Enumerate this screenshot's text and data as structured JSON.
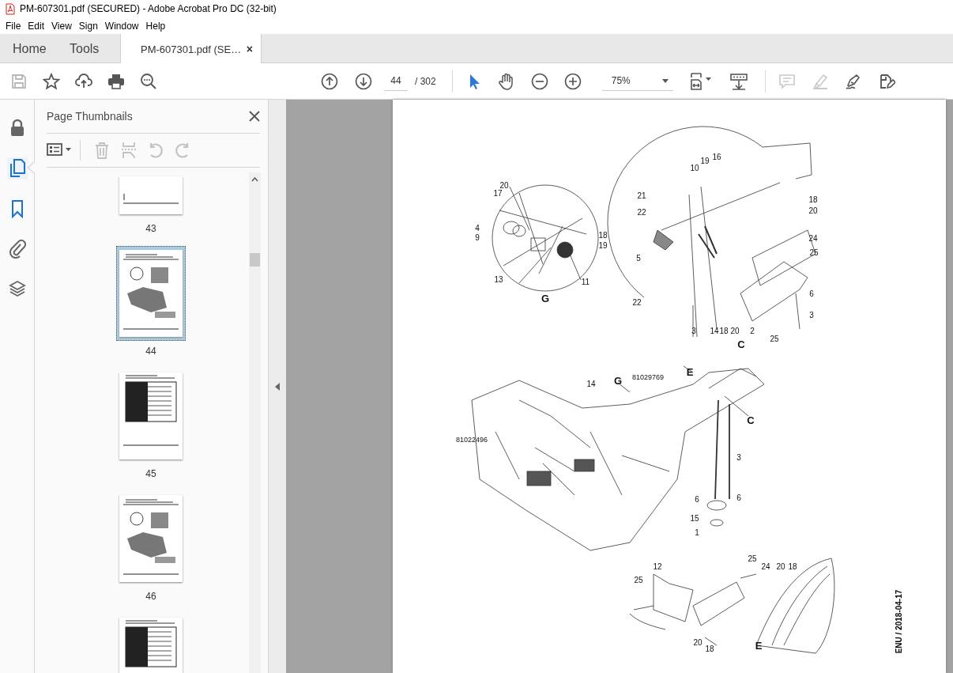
{
  "window": {
    "title": "PM-607301.pdf (SECURED) - Adobe Acrobat Pro DC (32-bit)"
  },
  "menu": [
    "File",
    "Edit",
    "View",
    "Sign",
    "Window",
    "Help"
  ],
  "tabs": [
    {
      "label": "Home",
      "selected": false,
      "kind": "nav"
    },
    {
      "label": "Tools",
      "selected": false,
      "kind": "nav"
    },
    {
      "label": "PM-607301.pdf (SE…",
      "selected": true,
      "kind": "document",
      "close": "×"
    }
  ],
  "toolbar": {
    "file_tools": [
      {
        "kind": "save",
        "disabled": true
      },
      {
        "kind": "star",
        "disabled": false
      },
      {
        "kind": "upload",
        "disabled": false
      },
      {
        "kind": "print",
        "disabled": false
      },
      {
        "kind": "find",
        "disabled": false
      }
    ],
    "page_number": "44",
    "page_count": "/ 302",
    "view_tools": [
      {
        "kind": "select",
        "selected": true
      },
      {
        "kind": "hand",
        "selected": false
      }
    ],
    "zoom": "75%",
    "edit_tools": [
      {
        "kind": "comment",
        "disabled": true
      },
      {
        "kind": "highlight",
        "disabled": true
      },
      {
        "kind": "sign",
        "disabled": false
      },
      {
        "kind": "edit",
        "disabled": false
      }
    ]
  },
  "rail": [
    {
      "kind": "lock",
      "selected": false
    },
    {
      "kind": "pages",
      "selected": true
    },
    {
      "kind": "bookmark",
      "selected": false
    },
    {
      "kind": "attachment",
      "selected": false
    },
    {
      "kind": "layers",
      "selected": false
    }
  ],
  "panel": {
    "title": "Page Thumbnails",
    "tools": [
      {
        "kind": "options",
        "disabled": false
      },
      {
        "kind": "delete",
        "disabled": true
      },
      {
        "kind": "extract",
        "disabled": true
      },
      {
        "kind": "undo",
        "disabled": true
      },
      {
        "kind": "redo",
        "disabled": true
      }
    ],
    "thumbnails": [
      {
        "label": "43",
        "selected": false,
        "kind": "blank"
      },
      {
        "label": "44",
        "selected": true,
        "kind": "drawing"
      },
      {
        "label": "45",
        "selected": false,
        "kind": "table"
      },
      {
        "label": "46",
        "selected": false,
        "kind": "drawing"
      },
      {
        "selected": false,
        "kind": "table"
      }
    ]
  },
  "document": {
    "callouts": [
      {
        "text": "20",
        "kind": "number"
      },
      {
        "text": "17",
        "kind": "number"
      },
      {
        "text": "4",
        "kind": "number"
      },
      {
        "text": "9",
        "kind": "number"
      },
      {
        "text": "18",
        "kind": "number"
      },
      {
        "text": "19",
        "kind": "number"
      },
      {
        "text": "13",
        "kind": "number"
      },
      {
        "text": "11",
        "kind": "number"
      },
      {
        "text": "G",
        "kind": "view"
      },
      {
        "text": "21",
        "kind": "number"
      },
      {
        "text": "22",
        "kind": "number"
      },
      {
        "text": "10",
        "kind": "number"
      },
      {
        "text": "19",
        "kind": "number"
      },
      {
        "text": "16",
        "kind": "number"
      },
      {
        "text": "18",
        "kind": "number"
      },
      {
        "text": "20",
        "kind": "number"
      },
      {
        "text": "24",
        "kind": "number"
      },
      {
        "text": "25",
        "kind": "number"
      },
      {
        "text": "5",
        "kind": "number"
      },
      {
        "text": "22",
        "kind": "number"
      },
      {
        "text": "6",
        "kind": "number"
      },
      {
        "text": "3",
        "kind": "number"
      },
      {
        "text": "3",
        "kind": "number"
      },
      {
        "text": "14",
        "kind": "number"
      },
      {
        "text": "18",
        "kind": "number"
      },
      {
        "text": "20",
        "kind": "number"
      },
      {
        "text": "2",
        "kind": "number"
      },
      {
        "text": "25",
        "kind": "number"
      },
      {
        "text": "C",
        "kind": "view"
      },
      {
        "text": "E",
        "kind": "view"
      },
      {
        "text": "14",
        "kind": "number"
      },
      {
        "text": "G",
        "kind": "view"
      },
      {
        "text": "81029769",
        "kind": "part"
      },
      {
        "text": "C",
        "kind": "view"
      },
      {
        "text": "81022496",
        "kind": "part"
      },
      {
        "text": "3",
        "kind": "number"
      },
      {
        "text": "6",
        "kind": "number"
      },
      {
        "text": "6",
        "kind": "number"
      },
      {
        "text": "15",
        "kind": "number"
      },
      {
        "text": "1",
        "kind": "number"
      },
      {
        "text": "12",
        "kind": "number"
      },
      {
        "text": "25",
        "kind": "number"
      },
      {
        "text": "25",
        "kind": "number"
      },
      {
        "text": "24",
        "kind": "number"
      },
      {
        "text": "20",
        "kind": "number"
      },
      {
        "text": "18",
        "kind": "number"
      },
      {
        "text": "20",
        "kind": "number"
      },
      {
        "text": "18",
        "kind": "number"
      },
      {
        "text": "E",
        "kind": "view"
      }
    ],
    "date_stamp": "ENU / 2018-04-17"
  }
}
